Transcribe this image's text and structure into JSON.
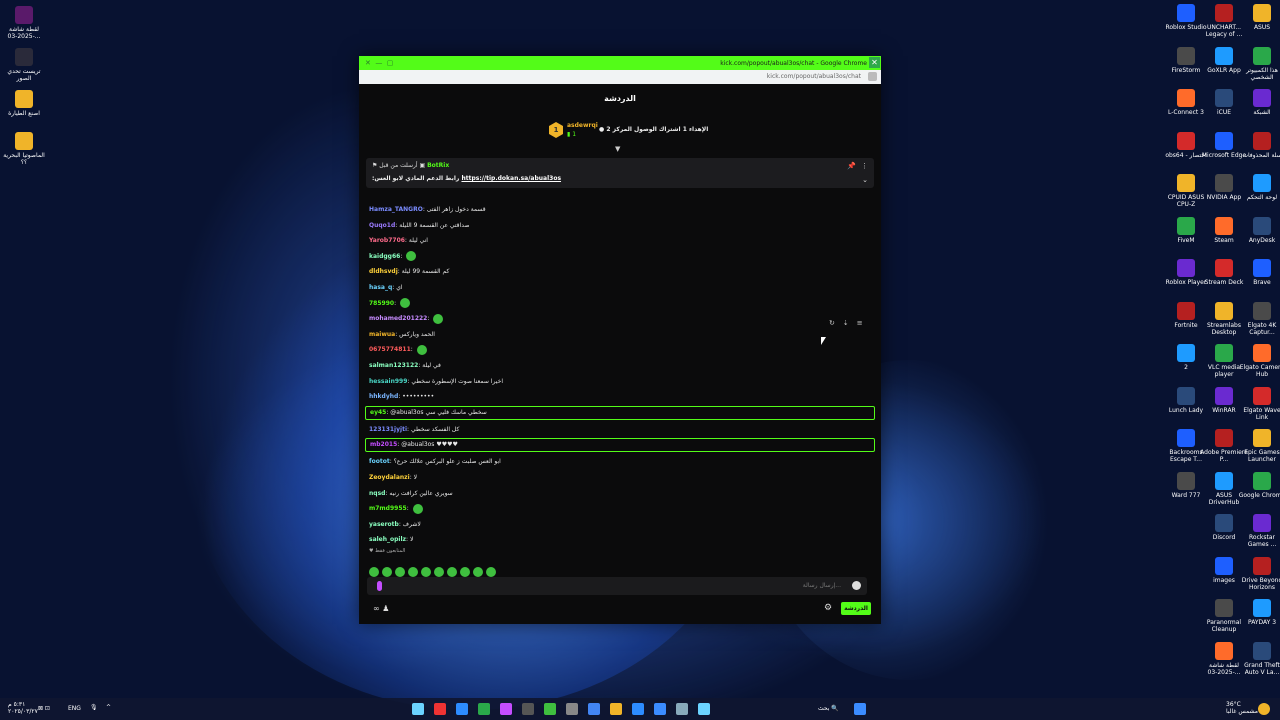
{
  "desktop": {
    "left_icons": [
      "لقطة شاشة 2025-03-...",
      "تريست تحدي الصور",
      "اصنع الطيارة",
      "الماصوتيا البحرية ؟؟"
    ],
    "right_icons": [
      [
        "Roblox Studio",
        "UNCHART... Legacy of ...",
        "ASUS"
      ],
      [
        "FireStorm",
        "GoXLR App",
        "هذا الكمبيوتر الشخصي"
      ],
      [
        "L-Connect 3",
        "iCUE",
        "الشبكة"
      ],
      [
        "obs64 - اختصار",
        "Microsoft Edge",
        "سلة المحذوفات"
      ],
      [
        "CPUID ASUS CPU-Z",
        "NVIDIA App",
        "لوحة التحكم"
      ],
      [
        "FiveM",
        "Steam",
        "AnyDesk"
      ],
      [
        "Roblox Player",
        "Stream Deck",
        "Brave"
      ],
      [
        "Fortnite",
        "Streamlabs Desktop",
        "Elgato 4K Captur..."
      ],
      [
        "2",
        "VLC media player",
        "Elgato Camera Hub"
      ],
      [
        "Lunch Lady",
        "WinRAR",
        "Elgato Wave Link"
      ],
      [
        "Backrooms Escape T...",
        "Adobe Premiere P...",
        "Epic Games Launcher"
      ],
      [
        "Ward 777",
        "ASUS DriverHub",
        "Google Chrome"
      ],
      [
        "",
        "Discord",
        "Rockstar Games ..."
      ],
      [
        "",
        "images",
        "Drive Beyond Horizons"
      ],
      [
        "",
        "Paranormal Cleanup",
        "PAYDAY 3"
      ],
      [
        "",
        "لقطة شاشة 2025-03-...",
        "Grand Theft Auto V La..."
      ]
    ]
  },
  "window": {
    "title": "kick.com/popout/abual3os/chat - Google Chrome",
    "url": "kick.com/popout/abual3os/chat"
  },
  "chat": {
    "header": "الدردشة",
    "leaderboard": {
      "rank": "1",
      "name": "asdewrqi",
      "count": "1",
      "text": "الإهداء 1 اشتراك الوصول المركز 2"
    },
    "pinned": {
      "line1_prefix": "أرسلت من قبل",
      "bot": "BotRix",
      "line2_text": ":رابط الدعم المادي لابو العس",
      "link": "https://tip.dokan.sa/abual3os"
    },
    "messages": [
      {
        "user": "Hamza_TANGRO",
        "color": "#7b8cff",
        "text": "قسمة دخول زاهر الفتى"
      },
      {
        "user": "Quqo1d",
        "color": "#9b7bff",
        "text": "صداقتي عن القسمة 9 الليلة"
      },
      {
        "user": "Yarob7706",
        "color": "#ff6b8b",
        "text": "اني ليلة"
      },
      {
        "user": "kaidgg66",
        "color": "#8affc0",
        "text": ""
      },
      {
        "user": "dldhsvdj",
        "color": "#ffd23a",
        "text": "كم القسمة 99 ليلة"
      },
      {
        "user": "hasa_q",
        "color": "#6bd3ff",
        "text": "اي"
      },
      {
        "user": "785990",
        "color": "#53fc18",
        "text": ""
      },
      {
        "user": "mohamed201222",
        "color": "#c78bff",
        "text": ""
      },
      {
        "user": "maiwua",
        "color": "#f0b429",
        "text": "الحمد وياركس"
      },
      {
        "user": "0675774811",
        "color": "#ff5c5c",
        "text": ""
      },
      {
        "user": "salman123122",
        "color": "#8affc0",
        "text": "في ليلة"
      },
      {
        "user": "hessain999",
        "color": "#4ad6c6",
        "text": "اخيرا سمعنا صوت الإسطورة سخطي"
      },
      {
        "user": "hhkdyhd",
        "color": "#7bb6ff",
        "text": "•••••••••"
      },
      {
        "user": "ey45",
        "color": "#53fc18",
        "text": "@abual3os سخطي ماسك فليي سي",
        "highlight": true
      },
      {
        "user": "123131jyjti",
        "color": "#7b8cff",
        "text": "كل الفسكد سخطي"
      },
      {
        "user": "mb2015",
        "color": "#c44dff",
        "text": "@abual3os ♥♥♥♥",
        "highlight": true
      },
      {
        "user": "footot",
        "color": "#6bd3ff",
        "text": "ابو العس صلبت ز علو البركس علالك حرع؟"
      },
      {
        "user": "Zeoydalanzi",
        "color": "#ffd23a",
        "text": "لا"
      },
      {
        "user": "nqsd",
        "color": "#8affc0",
        "text": "سويري عالين كرافت رنيه"
      },
      {
        "user": "m7md9955",
        "color": "#53fc18",
        "text": ""
      },
      {
        "user": "yaserotb",
        "color": "#8affc0",
        "text": "لاشرف"
      },
      {
        "user": "saleh_opilz",
        "color": "#8affc0",
        "text": "لا"
      }
    ],
    "followers_label": "المتابعون فقط",
    "input_placeholder": "إرسال رسالة...",
    "send_label": "الدردشة"
  },
  "taskbar": {
    "time": "٥:٣١ م",
    "date": "٢٠٢٥/٠٣/٢٧",
    "lang": "ENG",
    "search": "بحث",
    "weather_temp": "36°C",
    "weather_desc": "مشمس غالبا"
  },
  "colors": {
    "kick_green": "#53fc18",
    "background": "#0b0b0c"
  }
}
